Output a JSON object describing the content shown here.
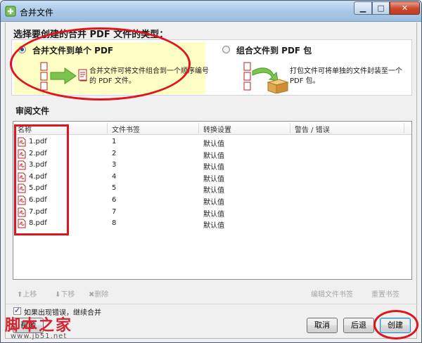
{
  "window": {
    "title": "合并文件",
    "controls": {
      "minimize": "▁",
      "maximize": "□",
      "close": "✕"
    }
  },
  "heading": "选择要创建的合并 PDF 文件的类型：",
  "options": {
    "single": {
      "label": "合并文件到单个 PDF",
      "description": "合并文件可将文件组合到一个顺序编号的 PDF 文件。",
      "selected": true
    },
    "portfolio": {
      "label": "组合文件到 PDF 包",
      "description": "打包文件可将单独的文件封装至一个 PDF 包。",
      "selected": false
    }
  },
  "section_label": "审阅文件",
  "list": {
    "columns": [
      "名称",
      "文件书签",
      "转换设置",
      "警告 / 错误"
    ],
    "rows": [
      {
        "name": "1.pdf",
        "bookmark": "1",
        "conversion": "默认值",
        "warning": ""
      },
      {
        "name": "2.pdf",
        "bookmark": "2",
        "conversion": "默认值",
        "warning": ""
      },
      {
        "name": "3.pdf",
        "bookmark": "3",
        "conversion": "默认值",
        "warning": ""
      },
      {
        "name": "4.pdf",
        "bookmark": "4",
        "conversion": "默认值",
        "warning": ""
      },
      {
        "name": "5.pdf",
        "bookmark": "5",
        "conversion": "默认值",
        "warning": ""
      },
      {
        "name": "6.pdf",
        "bookmark": "6",
        "conversion": "默认值",
        "warning": ""
      },
      {
        "name": "7.pdf",
        "bookmark": "7",
        "conversion": "默认值",
        "warning": ""
      },
      {
        "name": "8.pdf",
        "bookmark": "8",
        "conversion": "默认值",
        "warning": ""
      }
    ]
  },
  "toolbar": {
    "move_up": "上移",
    "move_down": "下移",
    "delete": "删除",
    "edit_bookmark": "编辑文件书签",
    "reset_bookmark": "重置书签"
  },
  "continue_on_error": {
    "label": "如果出现错误，继续合并",
    "checked": true
  },
  "buttons": {
    "help": "帮助",
    "cancel": "取消",
    "back": "后退",
    "create": "创建"
  },
  "watermark": {
    "main": "脚本之家",
    "sub": "www.jb51.net"
  },
  "colors": {
    "accent": "#2f4f87",
    "selected_option_bg": "#feffc4",
    "annotation_red": "#e0141c",
    "pdf_red": "#c8201f"
  }
}
